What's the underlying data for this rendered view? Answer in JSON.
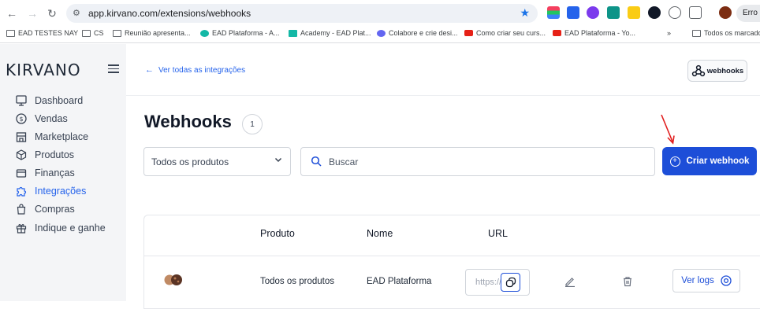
{
  "browser": {
    "url": "app.kirvano.com/extensions/webhooks",
    "profile_label": "Erro",
    "bookmarks": [
      {
        "label": "EAD TESTES NAY",
        "icon": "folder-icon"
      },
      {
        "label": "CS",
        "icon": "folder-icon"
      },
      {
        "label": "Reunião apresenta...",
        "icon": "folder-icon"
      },
      {
        "label": "EAD Plataforma - A...",
        "icon": "site-icon"
      },
      {
        "label": "Academy - EAD Plat...",
        "icon": "site-icon"
      },
      {
        "label": "Colabore e crie desi...",
        "icon": "canva-icon"
      },
      {
        "label": "Como criar seu curs...",
        "icon": "youtube-icon"
      },
      {
        "label": "EAD Plataforma - Yo...",
        "icon": "youtube-icon"
      },
      {
        "label": "»",
        "icon": ""
      },
      {
        "label": "Todos os marcado",
        "icon": "folder-icon"
      }
    ]
  },
  "sidebar": {
    "logo": "KIRVANO",
    "items": [
      {
        "label": "Dashboard",
        "icon": "dashboard-icon",
        "active": false
      },
      {
        "label": "Vendas",
        "icon": "dollar-icon",
        "active": false
      },
      {
        "label": "Marketplace",
        "icon": "store-icon",
        "active": false
      },
      {
        "label": "Produtos",
        "icon": "box-icon",
        "active": false
      },
      {
        "label": "Finanças",
        "icon": "wallet-icon",
        "active": false
      },
      {
        "label": "Integrações",
        "icon": "puzzle-icon",
        "active": true
      },
      {
        "label": "Compras",
        "icon": "bag-icon",
        "active": false
      },
      {
        "label": "Indique e ganhe",
        "icon": "gift-icon",
        "active": false
      }
    ]
  },
  "header": {
    "back_label": "Ver todas as integrações",
    "badge_label": "webhooks"
  },
  "page": {
    "title": "Webhooks",
    "count": "1",
    "filter_value": "Todos os produtos",
    "search_placeholder": "Buscar",
    "create_label": "Criar webhook"
  },
  "table": {
    "columns": [
      "Produto",
      "Nome",
      "URL"
    ],
    "rows": [
      {
        "product": "Todos os produtos",
        "name": "EAD Plataforma",
        "url": "https://",
        "logs_label": "Ver logs"
      }
    ]
  },
  "colors": {
    "accent": "#1d4ed8",
    "link": "#2563eb",
    "sidebar_bg": "#f4f5f7",
    "annotation_arrow": "#e11d1d"
  }
}
